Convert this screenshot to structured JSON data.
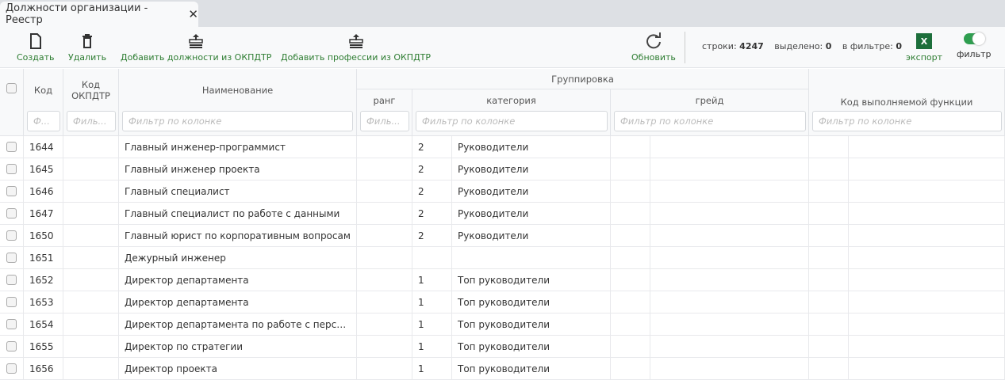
{
  "tab": {
    "title": "Должности организации - Реестр"
  },
  "toolbar": {
    "create": "Создать",
    "delete": "Удалить",
    "add_positions": "Добавить должности из ОКПДТР",
    "add_professions": "Добавить профессии из ОКПДТР",
    "refresh": "Обновить",
    "rows_label": "строки:",
    "rows": "4247",
    "selected_label": "выделено:",
    "selected": "0",
    "filtered_label": "в фильтре:",
    "filtered": "0",
    "export": "экспорт",
    "export_icon": "X",
    "filter": "фильтр",
    "filter_on": true
  },
  "columns": {
    "code": "Код",
    "okpdtr": "Код ОКПДТР",
    "name": "Наименование",
    "group": "Группировка",
    "rank": "ранг",
    "category": "категория",
    "grade": "грейд",
    "func": "Код выполняемой функции"
  },
  "filters": {
    "code": "Ф...",
    "okpdtr": "Филь...",
    "name": "Фильтр по колонке",
    "rank": "Филь...",
    "category": "Фильтр по колонке",
    "grade": "Фильтр по колонке",
    "func": "Фильтр по колонке"
  },
  "rows": [
    {
      "code": "1644",
      "name": "Главный инженер-программист",
      "catnum": "2",
      "cat": "Руководители"
    },
    {
      "code": "1645",
      "name": "Главный инженер проекта",
      "catnum": "2",
      "cat": "Руководители"
    },
    {
      "code": "1646",
      "name": "Главный специалист",
      "catnum": "2",
      "cat": "Руководители"
    },
    {
      "code": "1647",
      "name": "Главный специалист по работе с данными",
      "catnum": "2",
      "cat": "Руководители"
    },
    {
      "code": "1650",
      "name": "Главный юрист по корпоративным вопросам",
      "catnum": "2",
      "cat": "Руководители"
    },
    {
      "code": "1651",
      "name": "Дежурный инженер",
      "catnum": "",
      "cat": ""
    },
    {
      "code": "1652",
      "name": "Директор департамента",
      "catnum": "1",
      "cat": "Топ руководители"
    },
    {
      "code": "1653",
      "name": "Директор департамента",
      "catnum": "1",
      "cat": "Топ руководители"
    },
    {
      "code": "1654",
      "name": "Директор департамента по работе с персоналом",
      "catnum": "1",
      "cat": "Топ руководители"
    },
    {
      "code": "1655",
      "name": "Директор по стратегии",
      "catnum": "1",
      "cat": "Топ руководители"
    },
    {
      "code": "1656",
      "name": "Директор проекта",
      "catnum": "1",
      "cat": "Топ руководители"
    }
  ]
}
